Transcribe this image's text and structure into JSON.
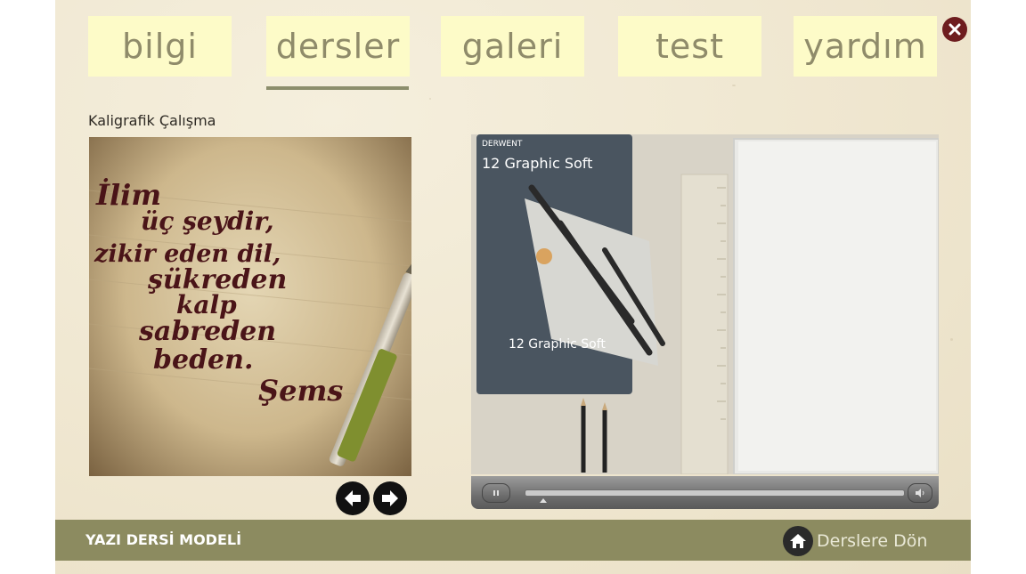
{
  "nav": {
    "tabs": [
      {
        "label": "bilgi"
      },
      {
        "label": "dersler"
      },
      {
        "label": "galeri"
      },
      {
        "label": "test"
      },
      {
        "label": "yardım"
      }
    ],
    "active_tab": "dersler"
  },
  "content": {
    "section_title": "Kaligrafik Çalışma",
    "calligraphy_text": [
      "İlim",
      "üç şeydir,",
      "zikir eden dil,",
      "şükreden",
      "kalp",
      "sabreden",
      "beden.",
      "Şems"
    ]
  },
  "video": {
    "box_brand": "DERWENT",
    "box_title": "12 Graphic Soft",
    "progress": 0.05
  },
  "footer": {
    "title": "YAZI DERSİ MODELİ",
    "back_label": "Derslere Dön"
  },
  "colors": {
    "tab_bg": "#fdfbc8",
    "tab_text": "#8f8b6a",
    "footer_bg": "#8c8b60",
    "close": "#6e1d1f",
    "ink": "#4a1418"
  },
  "icons": {
    "close": "close-icon",
    "prev": "arrow-left-icon",
    "next": "arrow-right-icon",
    "home": "home-icon",
    "play": "pause-icon",
    "volume": "volume-icon"
  }
}
